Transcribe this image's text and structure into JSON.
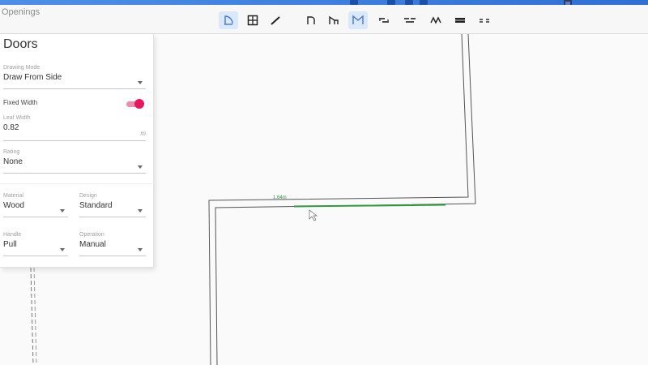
{
  "app": {
    "title": "Openings"
  },
  "toolbar": {
    "groups": [
      {
        "items": [
          {
            "icon": "door-plan-icon",
            "active": true
          },
          {
            "icon": "window-plan-icon",
            "active": false
          },
          {
            "icon": "line-tool-icon",
            "active": false
          }
        ]
      },
      {
        "items": [
          {
            "icon": "single-door-icon",
            "active": false
          },
          {
            "icon": "single-door-swing-icon",
            "active": false
          },
          {
            "icon": "double-door-icon",
            "active": true
          },
          {
            "icon": "sliding-door-icon",
            "active": false
          },
          {
            "icon": "pocket-door-icon",
            "active": false
          },
          {
            "icon": "bifold-door-icon",
            "active": false
          },
          {
            "icon": "garage-door-icon",
            "active": false
          },
          {
            "icon": "opening-icon",
            "active": false
          }
        ]
      }
    ]
  },
  "panel": {
    "title": "Doors",
    "drawing_mode": {
      "label": "Drawing Mode",
      "value": "Draw From Side"
    },
    "fixed_width": {
      "label": "Fixed Width",
      "on": true
    },
    "leaf_width": {
      "label": "Leaf Width",
      "value": "0.82",
      "unit": "m"
    },
    "rating": {
      "label": "Rating",
      "value": "None"
    },
    "material": {
      "label": "Material",
      "value": "Wood"
    },
    "design": {
      "label": "Design",
      "value": "Standard"
    },
    "handle": {
      "label": "Handle",
      "value": "Pull"
    },
    "operation": {
      "label": "Operation",
      "value": "Manual"
    }
  },
  "canvas": {
    "dimension_label": "1.64m"
  },
  "colors": {
    "accent": "#e8175d",
    "dimension": "#2e9a3e",
    "wall": "#555555",
    "active_tool_bg": "#d9e8fb"
  }
}
